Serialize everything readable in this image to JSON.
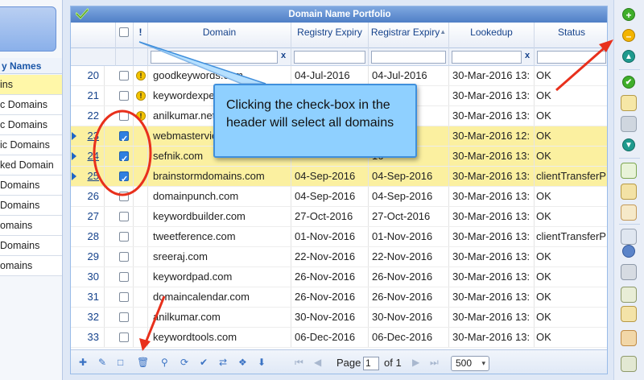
{
  "sidebar": {
    "heading": "y Names",
    "items": [
      {
        "label": "ins",
        "active": true
      },
      {
        "label": "c Domains"
      },
      {
        "label": "c Domains"
      },
      {
        "label": "ic Domains"
      },
      {
        "label": "ked Domain"
      },
      {
        "label": "Domains"
      },
      {
        "label": "Domains"
      },
      {
        "label": "omains"
      },
      {
        "label": "Domains"
      },
      {
        "label": "omains"
      }
    ]
  },
  "grid": {
    "title": "Domain Name Portfolio",
    "columns": {
      "warn": "!",
      "domain": "Domain",
      "registry_expiry": "Registry Expiry",
      "registrar_expiry": "Registrar Expiry",
      "lookedup": "Lookedup",
      "status": "Status"
    },
    "filter_clear": "x",
    "rows": [
      {
        "num": "20",
        "domain": "goodkeywords.com",
        "reg": "04-Jul-2016",
        "rar": "04-Jul-2016",
        "look": "30-Mar-2016 13:",
        "status": "OK",
        "warn": true,
        "checked": false,
        "sel": false
      },
      {
        "num": "21",
        "domain": "keywordexpert.com",
        "reg": "",
        "rar": "16",
        "look": "30-Mar-2016 13:",
        "status": "OK",
        "warn": true,
        "checked": false,
        "sel": false
      },
      {
        "num": "22",
        "domain": "anilkumar.net",
        "reg": "",
        "rar": "16",
        "look": "30-Mar-2016 13:",
        "status": "OK",
        "warn": true,
        "checked": false,
        "sel": false
      },
      {
        "num": "23",
        "domain": "webmasterview.com",
        "reg": "",
        "rar": "",
        "look": "30-Mar-2016 12:",
        "status": "OK",
        "warn": false,
        "checked": true,
        "sel": true
      },
      {
        "num": "24",
        "domain": "sefnik.com",
        "reg": "",
        "rar": "16",
        "look": "30-Mar-2016 13:",
        "status": "OK",
        "warn": false,
        "checked": true,
        "sel": true
      },
      {
        "num": "25",
        "domain": "brainstormdomains.com",
        "reg": "04-Sep-2016",
        "rar": "04-Sep-2016",
        "look": "30-Mar-2016 13:",
        "status": "clientTransferP",
        "warn": false,
        "checked": true,
        "sel": true
      },
      {
        "num": "26",
        "domain": "domainpunch.com",
        "reg": "04-Sep-2016",
        "rar": "04-Sep-2016",
        "look": "30-Mar-2016 13:",
        "status": "OK",
        "warn": false,
        "checked": false,
        "sel": false
      },
      {
        "num": "27",
        "domain": "keywordbuilder.com",
        "reg": "27-Oct-2016",
        "rar": "27-Oct-2016",
        "look": "30-Mar-2016 13:",
        "status": "OK",
        "warn": false,
        "checked": false,
        "sel": false
      },
      {
        "num": "28",
        "domain": "tweetference.com",
        "reg": "01-Nov-2016",
        "rar": "01-Nov-2016",
        "look": "30-Mar-2016 13:",
        "status": "clientTransferP",
        "warn": false,
        "checked": false,
        "sel": false
      },
      {
        "num": "29",
        "domain": "sreeraj.com",
        "reg": "22-Nov-2016",
        "rar": "22-Nov-2016",
        "look": "30-Mar-2016 13:",
        "status": "OK",
        "warn": false,
        "checked": false,
        "sel": false
      },
      {
        "num": "30",
        "domain": "keywordpad.com",
        "reg": "26-Nov-2016",
        "rar": "26-Nov-2016",
        "look": "30-Mar-2016 13:",
        "status": "OK",
        "warn": false,
        "checked": false,
        "sel": false
      },
      {
        "num": "31",
        "domain": "domaincalendar.com",
        "reg": "26-Nov-2016",
        "rar": "26-Nov-2016",
        "look": "30-Mar-2016 13:",
        "status": "OK",
        "warn": false,
        "checked": false,
        "sel": false
      },
      {
        "num": "32",
        "domain": "anilkumar.com",
        "reg": "30-Nov-2016",
        "rar": "30-Nov-2016",
        "look": "30-Mar-2016 13:",
        "status": "OK",
        "warn": false,
        "checked": false,
        "sel": false
      },
      {
        "num": "33",
        "domain": "keywordtools.com",
        "reg": "06-Dec-2016",
        "rar": "06-Dec-2016",
        "look": "30-Mar-2016 13:",
        "status": "OK",
        "warn": false,
        "checked": false,
        "sel": false
      }
    ]
  },
  "pager": {
    "page_label": "Page",
    "page_value": "1",
    "of_label": "of 1",
    "page_size": "500"
  },
  "callout": {
    "text": "Clicking the check-box in the header will select all domains"
  },
  "colors": {
    "selected_row": "#fbf0a0",
    "callout_bg": "#8fd0ff",
    "annotation_red": "#e8301c",
    "accent_blue": "#15428b"
  }
}
